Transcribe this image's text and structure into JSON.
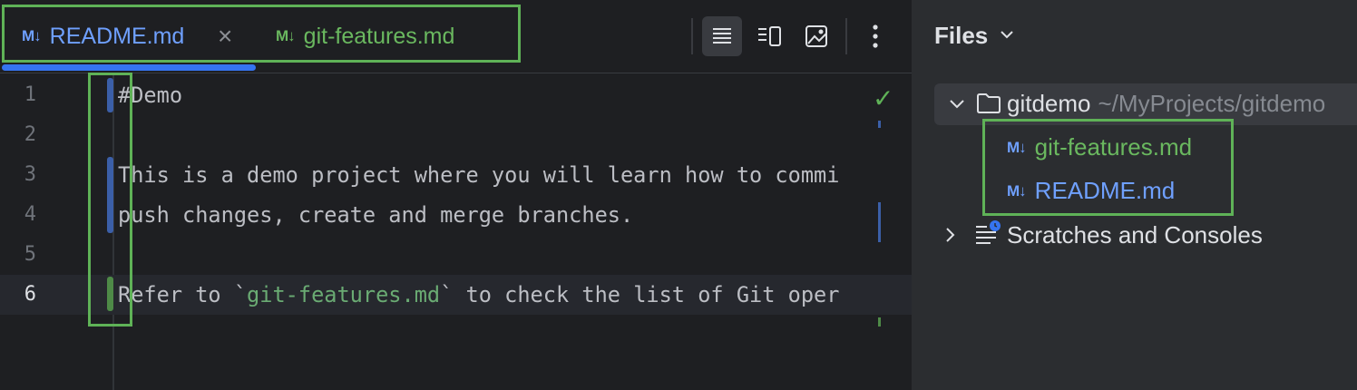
{
  "editor": {
    "tabs": [
      {
        "label": "README.md",
        "icon": "markdown-icon",
        "color": "#6fa0ff",
        "active": true
      },
      {
        "label": "git-features.md",
        "icon": "markdown-icon",
        "color": "#6ab85f",
        "active": false
      }
    ],
    "md_icon_text": "M↓",
    "toolbar": [
      "editor-only-icon",
      "editor-and-preview-icon",
      "preview-only-icon",
      "more-options-icon"
    ],
    "lines": [
      {
        "number": "1",
        "text": "#Demo"
      },
      {
        "number": "2",
        "text": ""
      },
      {
        "number": "3",
        "text": "This is a demo project where you will learn how to commi"
      },
      {
        "number": "4",
        "text": "push changes, create and merge branches."
      },
      {
        "number": "5",
        "text": ""
      },
      {
        "number": "6",
        "pre": "Refer to `",
        "code": "git-features.md",
        "post": "` to check the list of Git oper"
      }
    ],
    "current_line": "6"
  },
  "files_panel": {
    "title": "Files",
    "root": {
      "name": "gitdemo",
      "path": "~/MyProjects/gitdemo"
    },
    "files": [
      {
        "name": "git-features.md",
        "color": "#6ab85f"
      },
      {
        "name": "README.md",
        "color": "#6fa0ff"
      }
    ],
    "scratches": "Scratches and Consoles"
  },
  "colors": {
    "accent": "#3574f0",
    "highlight_box": "#5fb257",
    "added": "#4e8a47",
    "modified": "#3b5fa8"
  }
}
